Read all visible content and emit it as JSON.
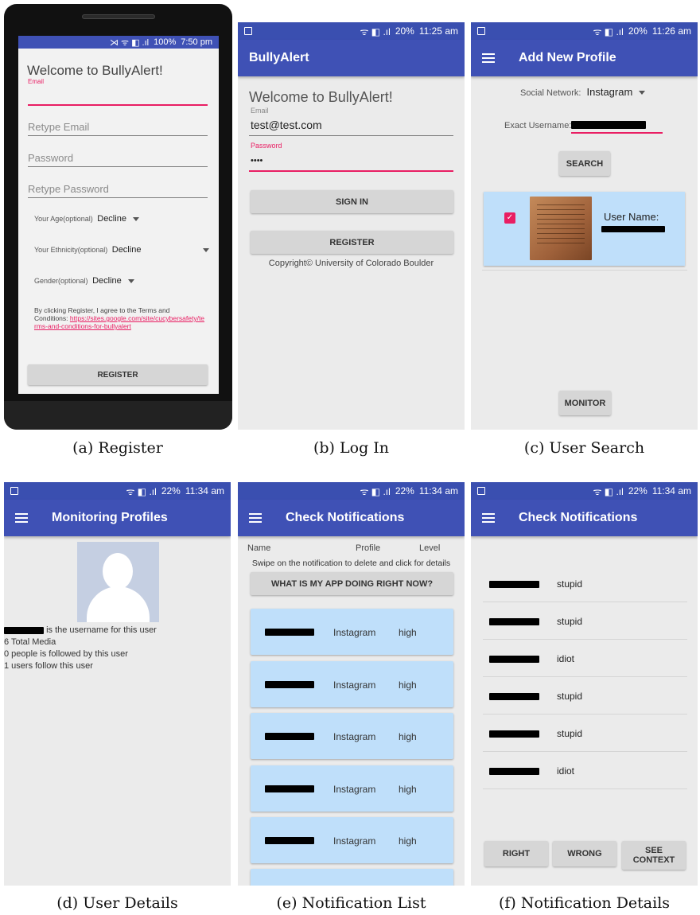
{
  "register": {
    "status": {
      "icons": "⋊ ᯤ ◧ .ıl",
      "battery": "100%",
      "time": "7:50 pm"
    },
    "welcome": "Welcome to BullyAlert!",
    "email_label": "Email",
    "retype_email_placeholder": "Retype Email",
    "password_placeholder": "Password",
    "retype_password_placeholder": "Retype Password",
    "age_label": "Your Age(optional)",
    "age_value": "Decline",
    "ethnicity_label": "Your Ethnicity(optional)",
    "ethnicity_value": "Decline",
    "gender_label": "Gender(optional)",
    "gender_value": "Decline",
    "terms_text": "By clicking Register, I agree to the Terms and Conditions: ",
    "terms_link": "https://sites.google.com/site/cucybersafety/terms-and-conditions-for-bullyalert",
    "register_button": "REGISTER",
    "caption": "(a) Register"
  },
  "login": {
    "status": {
      "icons": "ᯤ ◧ .ıl",
      "battery": "20%",
      "time": "11:25 am"
    },
    "title": "BullyAlert",
    "welcome": "Welcome to BullyAlert!",
    "email_label": "Email",
    "email_value": "test@test.com",
    "password_label": "Password",
    "password_value": "••••",
    "signin_button": "SIGN IN",
    "register_button": "REGISTER",
    "copyright": "Copyright© University of Colorado Boulder",
    "caption": "(b) Log In"
  },
  "search": {
    "status": {
      "icons": "ᯤ ◧ .ıl",
      "battery": "20%",
      "time": "11:26 am"
    },
    "title": "Add New Profile",
    "network_label": "Social Network:",
    "network_value": "Instagram",
    "username_label": "Exact Username:",
    "search_button": "SEARCH",
    "user_name_label": "User Name:",
    "monitor_button": "MONITOR",
    "caption": "(c) User Search"
  },
  "details": {
    "status": {
      "icons": "ᯤ ◧ .ıl",
      "battery": "22%",
      "time": "11:34 am"
    },
    "title": "Monitoring Profiles",
    "username_suffix": "is the username for this user",
    "total_media": "6 Total Media",
    "followed": "0 people is followed by this user",
    "followers": "1 users follow this user",
    "caption": "(d) User Details"
  },
  "notif_list": {
    "status": {
      "icons": "ᯤ ◧ .ıl",
      "battery": "22%",
      "time": "11:34 am"
    },
    "title": "Check Notifications",
    "col_name": "Name",
    "col_profile": "Profile",
    "col_level": "Level",
    "hint": "Swipe on the notification to delete and click for details",
    "what_button": "WHAT IS MY APP DOING RIGHT NOW?",
    "rows": [
      {
        "profile": "Instagram",
        "level": "high"
      },
      {
        "profile": "Instagram",
        "level": "high"
      },
      {
        "profile": "Instagram",
        "level": "high"
      },
      {
        "profile": "Instagram",
        "level": "high"
      },
      {
        "profile": "Instagram",
        "level": "high"
      }
    ],
    "caption": "(e) Notification List"
  },
  "notif_detail": {
    "status": {
      "icons": "ᯤ ◧ .ıl",
      "battery": "22%",
      "time": "11:34 am"
    },
    "title": "Check Notifications",
    "rows": [
      {
        "word": "stupid"
      },
      {
        "word": "stupid"
      },
      {
        "word": "idiot"
      },
      {
        "word": "stupid"
      },
      {
        "word": "stupid"
      },
      {
        "word": "idiot"
      }
    ],
    "right_button": "RIGHT",
    "wrong_button": "WRONG",
    "context_button_line1": "SEE",
    "context_button_line2": "CONTEXT",
    "caption": "(f) Notification Details"
  }
}
